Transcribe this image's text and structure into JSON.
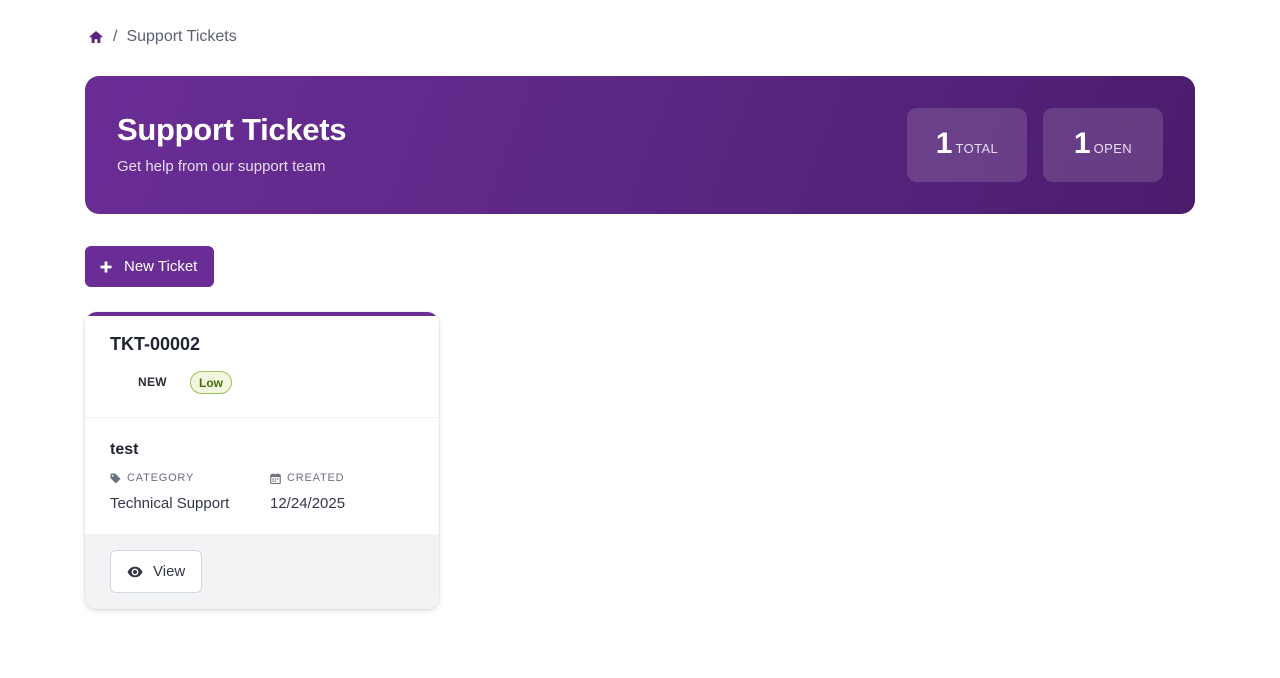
{
  "breadcrumb": {
    "home_icon": "home-icon",
    "separator": "/",
    "current": "Support Tickets"
  },
  "hero": {
    "title": "Support Tickets",
    "subtitle": "Get help from our support team",
    "stats": {
      "total": {
        "value": "1",
        "label": "TOTAL"
      },
      "open": {
        "value": "1",
        "label": "OPEN"
      }
    }
  },
  "actions": {
    "new_ticket_label": "New Ticket",
    "new_ticket_icon": "plus-icon"
  },
  "tickets": [
    {
      "id": "TKT-00002",
      "status": "NEW",
      "priority": "Low",
      "subject": "test",
      "category_label": "CATEGORY",
      "category_icon": "tag-icon",
      "category": "Technical Support",
      "created_label": "CREATED",
      "created_icon": "calendar-icon",
      "created": "12/24/2025",
      "view_label": "View",
      "view_icon": "eye-icon"
    }
  ],
  "colors": {
    "brand": "#6a2d95",
    "brand_dark": "#4b1c6c",
    "priority_low_bg": "#f1f7de",
    "priority_low_border": "#9fbf5a",
    "priority_low_text": "#4d6b10"
  }
}
